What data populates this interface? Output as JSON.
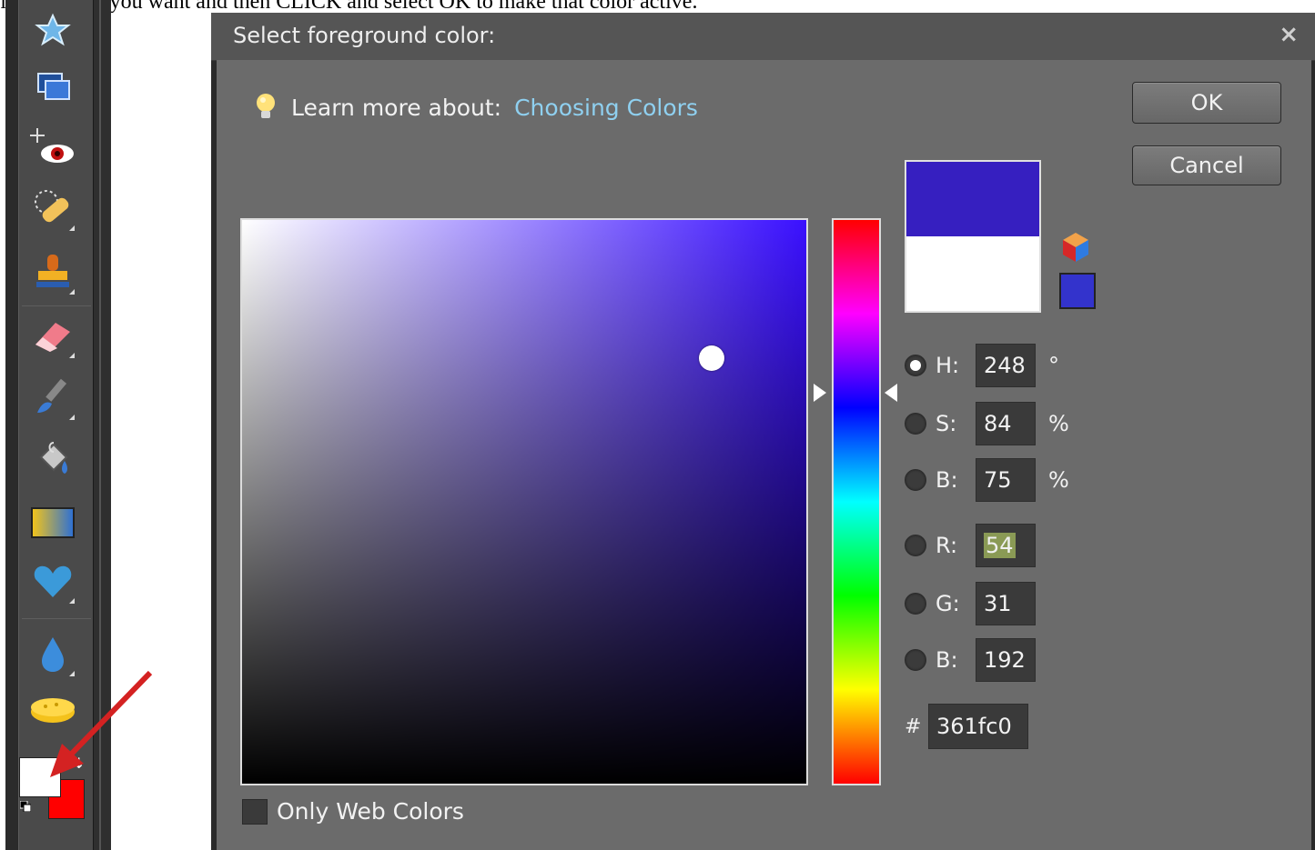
{
  "instruction": "find the one you want and then CLICK and select OK to make that color active.",
  "toolbar": {
    "tools": [
      "cookie-cutter-icon",
      "straighten-icon",
      "red-eye-removal-icon",
      "spot-healing-brush-icon",
      "clone-stamp-icon",
      "eraser-icon",
      "brush-icon",
      "paint-bucket-icon",
      "gradient-icon",
      "custom-shape-icon",
      "blur-icon",
      "sponge-icon"
    ],
    "foreground_color": "#ffffff",
    "background_color": "#ff0000"
  },
  "dialog": {
    "title": "Select foreground color:",
    "close_label": "×",
    "learn_prefix": "Learn more about:",
    "learn_link": "Choosing Colors",
    "ok_label": "OK",
    "cancel_label": "Cancel",
    "new_color": "#361fc0",
    "current_color": "#ffffff",
    "websafe_color": "#3333cc",
    "fields": {
      "h": {
        "label": "H:",
        "value": "248",
        "unit": "°"
      },
      "s": {
        "label": "S:",
        "value": "84",
        "unit": "%"
      },
      "b": {
        "label": "B:",
        "value": "75",
        "unit": "%"
      },
      "r": {
        "label": "R:",
        "value": "54"
      },
      "g": {
        "label": "G:",
        "value": "31"
      },
      "bl": {
        "label": "B:",
        "value": "192"
      }
    },
    "hex_label": "#",
    "hex_value": "361fc0",
    "only_web_colors_label": "Only Web Colors"
  },
  "annotation_color": "#d42222"
}
